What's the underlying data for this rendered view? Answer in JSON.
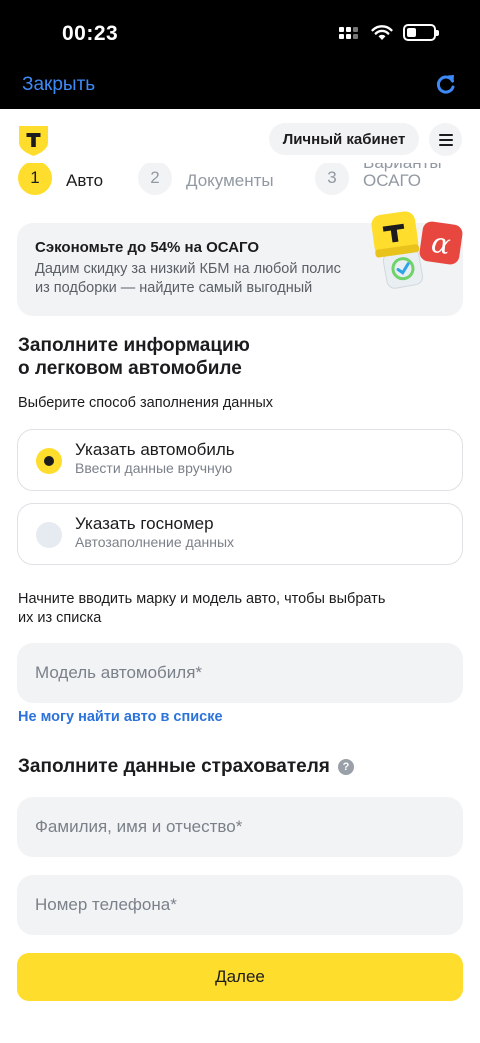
{
  "status_bar": {
    "time": "00:23"
  },
  "browser": {
    "close_label": "Закрыть"
  },
  "header": {
    "logo_letter": "Т",
    "cabinet_label": "Личный кабинет"
  },
  "steps": [
    {
      "number": "1",
      "label": "Авто",
      "state": "active"
    },
    {
      "number": "2",
      "label": "Документы",
      "state": "inactive"
    },
    {
      "number": "3",
      "label_line1": "Варианты",
      "label_line2": "ОСАГО",
      "state": "inactive"
    }
  ],
  "promo": {
    "title": "Сэкономьте до 54% на ОСАГО",
    "text": "Дадим скидку за низкий КБМ на любой полис из подборки — найдите самый выгодный"
  },
  "car_section": {
    "title_line1": "Заполните информацию",
    "title_line2": "о легковом автомобиле",
    "subtitle": "Выберите способ заполнения данных",
    "options": [
      {
        "title": "Указать автомобиль",
        "subtitle": "Ввести данные вручную",
        "selected": true
      },
      {
        "title": "Указать госномер",
        "subtitle": "Автозаполнение данных",
        "selected": false
      }
    ],
    "model_hint_line1": "Начните вводить марку и модель авто, чтобы выбрать",
    "model_hint_line2": "их из списка",
    "model_placeholder": "Модель автомобиля*",
    "not_found_link": "Не могу найти авто в списке"
  },
  "insurer_section": {
    "title": "Заполните данные страхователя",
    "help_icon": "?",
    "name_placeholder": "Фамилия, имя и отчество*",
    "phone_placeholder": "Номер телефона*"
  },
  "next_label": "Далее",
  "colors": {
    "accent": "#ffdd2d",
    "link": "#2b73db",
    "ios_blue": "#3d8af7",
    "field_bg": "#f2f3f5"
  }
}
